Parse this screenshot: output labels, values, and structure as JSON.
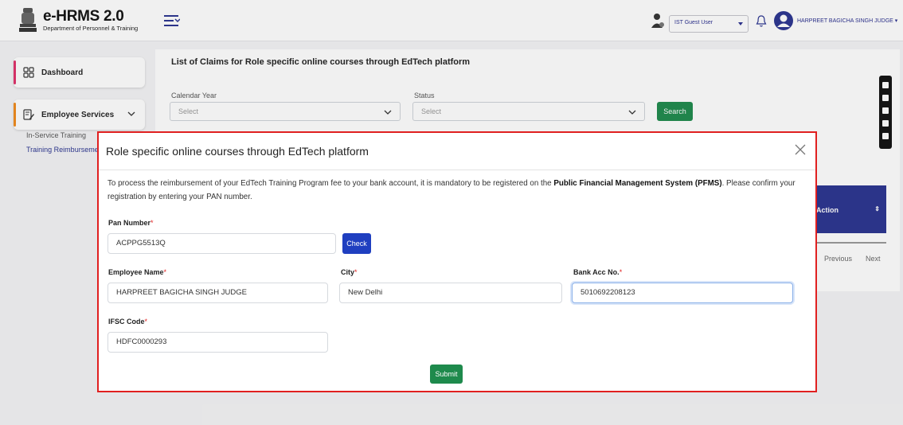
{
  "header": {
    "logo_title": "e-HRMS 2.0",
    "logo_subtitle": "Department of Personnel & Training",
    "role_select_value": "IST Guest User",
    "user_name": "HARPREET BAGICHA SINGH JUDGE"
  },
  "sidebar": {
    "dashboard_label": "Dashboard",
    "employee_services_label": "Employee Services",
    "sub_items": [
      "In-Service Training",
      "Training Reimburseme"
    ],
    "accent_dashboard": "#e0306a",
    "accent_services": "#f08a1c"
  },
  "main": {
    "title": "List of Claims for Role specific online courses through EdTech platform",
    "calendar_year_label": "Calendar Year",
    "calendar_year_placeholder": "Select",
    "status_label": "Status",
    "status_placeholder": "Select",
    "search_label": "Search",
    "action_column": "Action",
    "pager_previous": "Previous",
    "pager_next": "Next"
  },
  "modal": {
    "title": "Role specific online courses through EdTech platform",
    "intro_part1": "To process the reimbursement of your EdTech Training Program fee to your bank account, it is mandatory to be registered on the ",
    "intro_bold": "Public Financial Management System (PFMS)",
    "intro_part2": ". Please confirm your registration by entering your PAN number.",
    "pan_label": "Pan Number",
    "pan_value": "ACPPG5513Q",
    "check_label": "Check",
    "employee_name_label": "Employee Name",
    "employee_name_value": "HARPREET BAGICHA SINGH JUDGE",
    "city_label": "City",
    "city_value": "New Delhi",
    "bank_acc_label": "Bank Acc No.",
    "bank_acc_value": "5010692208123",
    "ifsc_label": "IFSC Code",
    "ifsc_value": "HDFC0000293",
    "submit_label": "Submit",
    "required_marker": "*"
  },
  "colors": {
    "primary_blue": "#1f3fc0",
    "navy": "#2a3490",
    "green": "#1e8a4c",
    "modal_border": "#e02020"
  }
}
